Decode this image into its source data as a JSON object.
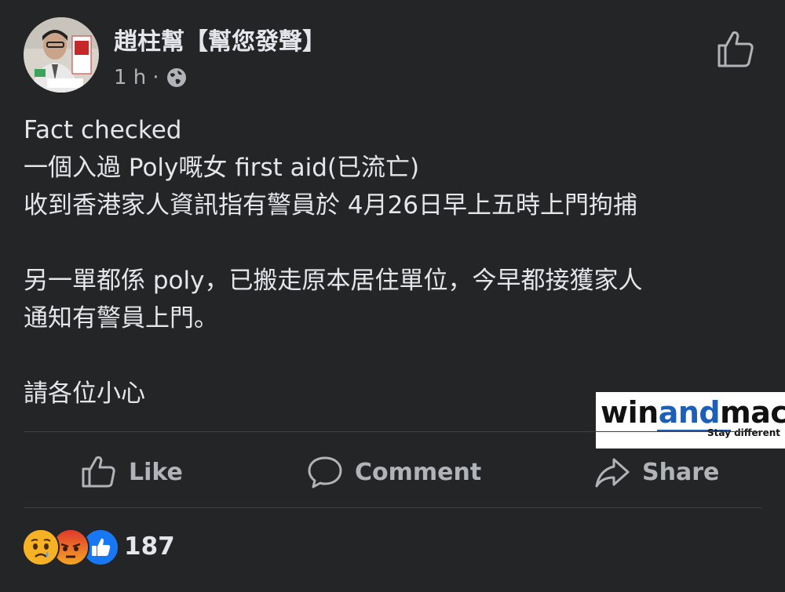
{
  "post": {
    "author": "趙柱幫【幫您發聲】",
    "time": "1 h",
    "separator": "·",
    "visibility_icon": "globe-icon",
    "text": {
      "line1": "Fact checked",
      "line2": "一個入過 Poly嘅女 first aid(已流亡)",
      "line3": "收到香港家人資訊指有警員於 4月26日早上五時上門拘捕",
      "line4": "另一單都係 poly，已搬走原本居住單位，今早都接獲家人",
      "line5": "通知有警員上門。",
      "line6": "請各位小心"
    }
  },
  "watermark": {
    "part1": "win",
    "part2": "and",
    "part3": "mac",
    "tagline": "Stay different"
  },
  "actions": {
    "like": "Like",
    "comment": "Comment",
    "share": "Share"
  },
  "reactions": {
    "types": [
      "sad",
      "angry",
      "like"
    ],
    "count": "187"
  },
  "colors": {
    "background": "#242526",
    "text": "#e4e6eb",
    "muted": "#b0b3b8",
    "like_blue": "#1877f2",
    "watermark_blue": "#1c5fb8"
  }
}
